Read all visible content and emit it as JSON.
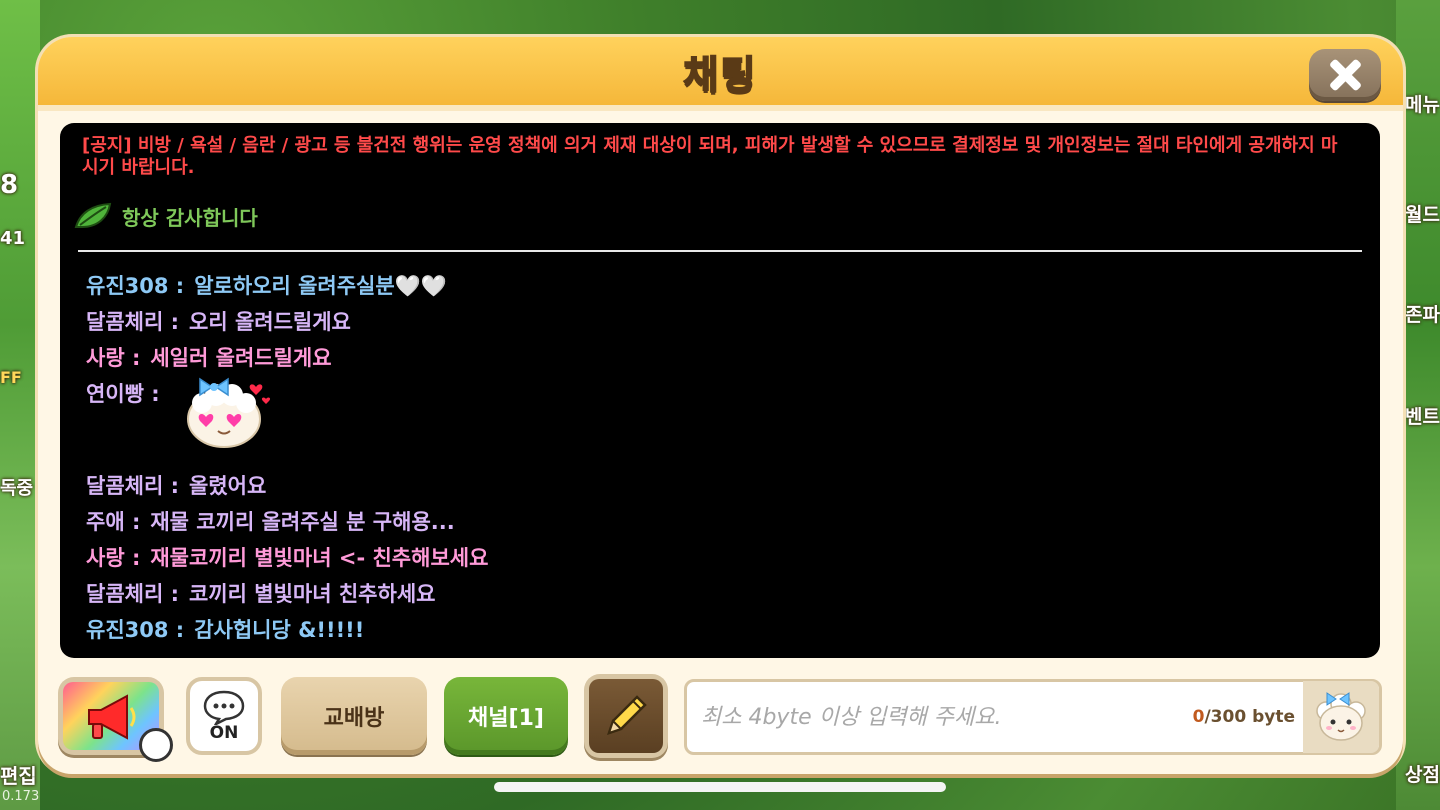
{
  "background": {
    "version": "0.173",
    "side_labels": {
      "menu": "메뉴",
      "world": "월드",
      "zone": "존파",
      "event": "이벤트",
      "edit": "편집",
      "shop": "상점",
      "lv": "8",
      "notify": "41",
      "off": "FF",
      "ing": "독중"
    }
  },
  "panel": {
    "title": "채팅",
    "close_icon": "close-icon"
  },
  "chat": {
    "notice": "[공지] 비방 / 욕설 / 음란 / 광고 등 불건전 행위는 운영 정책에 의거 제재 대상이 되며, 피해가 발생할 수 있으므로 결제정보 및 개인정보는 절대 타인에게 공개하지 마시기 바랍니다.",
    "pinned_text": "항상 감사합니다",
    "messages": [
      {
        "sender": "유진308 :",
        "text": "알로하오리 올려주실분🤍🤍",
        "color": "#8ec9f5"
      },
      {
        "sender": "달콤체리 :",
        "text": "오리 올려드릴게요",
        "color": "#d7b6f7"
      },
      {
        "sender": "사랑 :",
        "text": "세일러 올려드릴게요",
        "color": "#ff9ad8"
      },
      {
        "sender": "연이빵 :",
        "text": "",
        "color": "#d7b6f7",
        "sticker": "sheep-heart-eyes-sticker"
      },
      {
        "sender": "달콤체리 :",
        "text": "올렸어요",
        "color": "#d7b6f7"
      },
      {
        "sender": "주애 :",
        "text": "재물 코끼리 올려주실 분 구해용...",
        "color": "#d7b6f7"
      },
      {
        "sender": "사랑 :",
        "text": "재물코끼리 별빛마녀 <- 친추해보세요",
        "color": "#ff9ad8"
      },
      {
        "sender": "달콤체리 :",
        "text": "코끼리 별빛마녀 친추하세요",
        "color": "#d7b6f7"
      },
      {
        "sender": "유진308 :",
        "text": "감사헙니당 &!!!!!",
        "color": "#8ec9f5"
      }
    ]
  },
  "toolbar": {
    "megaphone_icon": "megaphone-icon",
    "chat_toggle_label": "ON",
    "exchange_label": "교배방",
    "channel_label": "채널[1]",
    "pencil_icon": "pencil-icon"
  },
  "input": {
    "placeholder": "최소 4byte 이상 입력해 주세요.",
    "value": "",
    "byte_current": "0",
    "byte_max": "/300 byte"
  },
  "colors": {
    "header": "#f5b73a",
    "notice": "#ff4a4a",
    "pinned": "#7fc85a",
    "channel_button": "#5a962a",
    "exchange_button": "#d4ba8c"
  }
}
